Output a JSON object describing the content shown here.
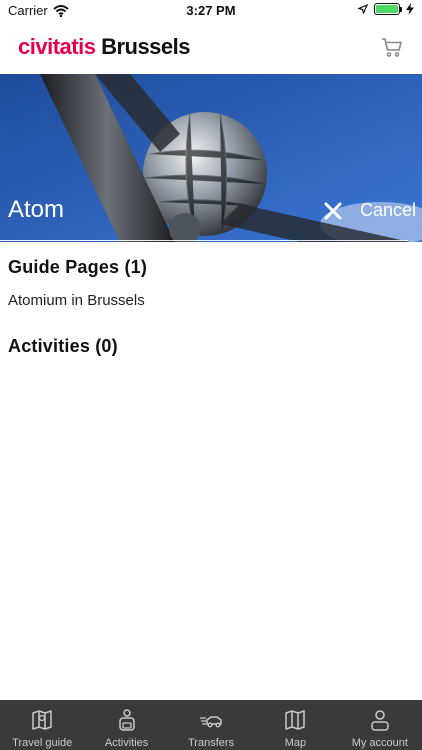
{
  "status": {
    "carrier": "Carrier",
    "time": "3:27 PM"
  },
  "header": {
    "brand": "civitatis",
    "city": "Brussels"
  },
  "search": {
    "value": "Atom",
    "cancel_label": "Cancel"
  },
  "results": {
    "guide_pages": {
      "title": "Guide Pages (1)",
      "items": [
        "Atomium in Brussels"
      ]
    },
    "activities": {
      "title": "Activities (0)"
    }
  },
  "tabs": [
    {
      "label": "Travel guide",
      "icon": "map-book-icon"
    },
    {
      "label": "Activities",
      "icon": "backpack-icon"
    },
    {
      "label": "Transfers",
      "icon": "transfer-car-icon"
    },
    {
      "label": "Map",
      "icon": "map-icon"
    },
    {
      "label": "My account",
      "icon": "user-icon"
    }
  ],
  "colors": {
    "brand": "#e5004f",
    "tabbar": "#3a3a3a",
    "battery": "#4cd964"
  }
}
